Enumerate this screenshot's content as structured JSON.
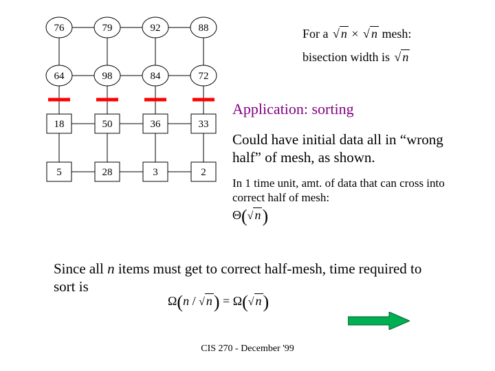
{
  "mesh": {
    "rows": [
      [
        "76",
        "79",
        "92",
        "88"
      ],
      [
        "64",
        "98",
        "84",
        "72"
      ],
      [
        "18",
        "50",
        "36",
        "33"
      ],
      [
        "5",
        "28",
        "3",
        "2"
      ]
    ],
    "plain_rows": [
      2,
      3
    ]
  },
  "formula": {
    "line1_a": "For a ",
    "line1_b": " × ",
    "line1_c": " mesh:",
    "line2_a": "bisection width is ",
    "n": "n"
  },
  "texts": {
    "app_title": "Application: sorting",
    "body1": "Could have initial data all in “wrong half” of mesh, as shown.",
    "body2": "In 1 time unit, amt. of data that can cross into correct half of mesh:",
    "body3_a": "Since all ",
    "body3_b": " items must get to correct half-mesh, time required to sort is",
    "n_ital": "n",
    "footer": "CIS 270 - December '99"
  },
  "symbols": {
    "Theta": "Θ",
    "Omega": "Ω"
  }
}
